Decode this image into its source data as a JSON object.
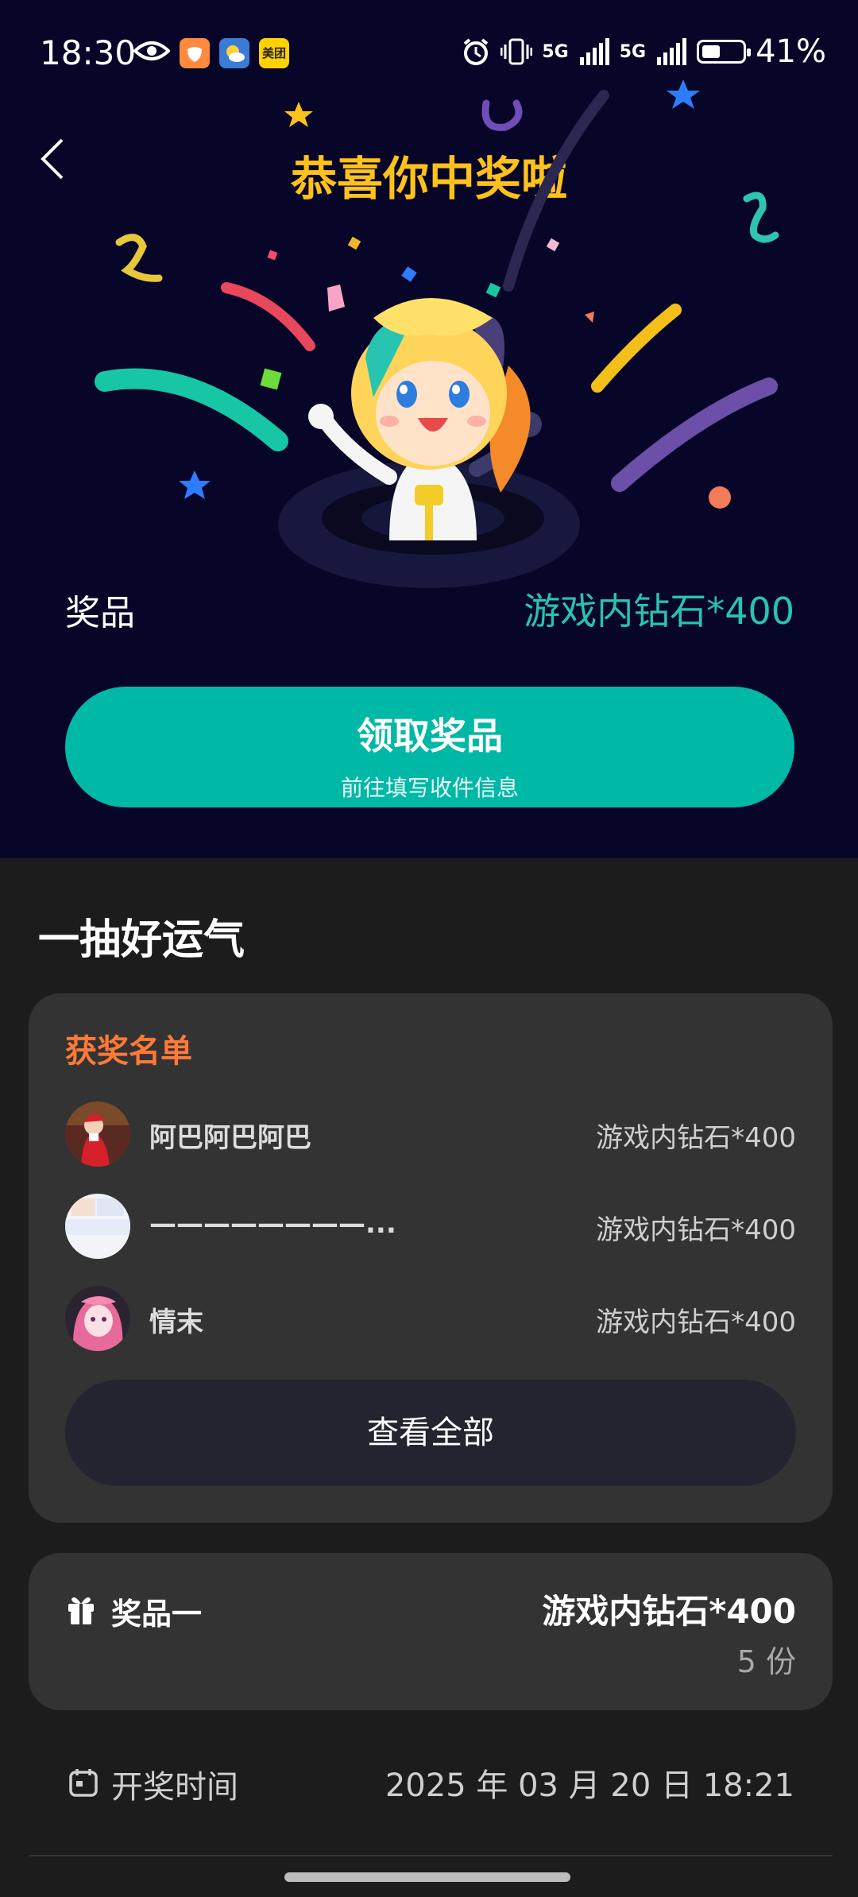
{
  "status_bar": {
    "time": "18:30",
    "network_1": "5G",
    "network_2": "5G",
    "battery": "41%",
    "app_icons": [
      "eye-icon",
      "shield-app-icon",
      "weather-app-icon",
      "meituan-app-icon"
    ],
    "meituan_label": "美团"
  },
  "header": {
    "title": "恭喜你中奖啦",
    "back_icon": "chevron-left-icon"
  },
  "prize": {
    "label": "奖品",
    "value": "游戏内钻石*400"
  },
  "claim_button": {
    "label": "领取奖品",
    "sublabel": "前往填写收件信息"
  },
  "section": {
    "title": "一抽好运气"
  },
  "winners": {
    "title": "获奖名单",
    "rows": [
      {
        "name": "阿巴阿巴阿巴",
        "prize": "游戏内钻石*400"
      },
      {
        "name": "————————...",
        "prize": "游戏内钻石*400"
      },
      {
        "name": "情末",
        "prize": "游戏内钻石*400"
      }
    ],
    "view_all": "查看全部"
  },
  "prize_card": {
    "label": "奖品一",
    "value": "游戏内钻石*400",
    "count": "5 份"
  },
  "draw_time": {
    "label": "开奖时间",
    "value": "2025 年 03 月 20 日 18:21"
  },
  "colors": {
    "hero_bg": "#080628",
    "title": "#ffc21a",
    "accent": "#00b8a6",
    "winners_title": "#ff7a38",
    "card_bg": "#333333",
    "page_bg": "#1c1c1c"
  }
}
